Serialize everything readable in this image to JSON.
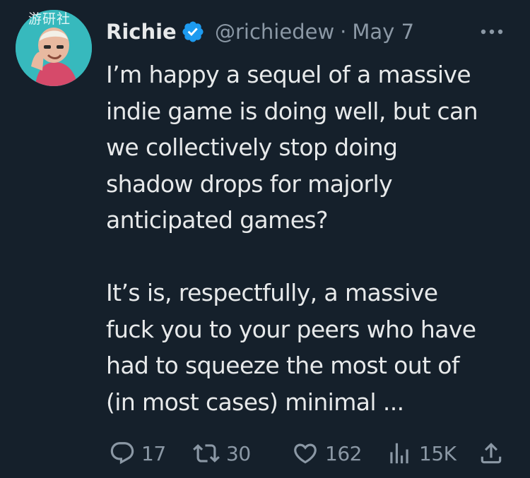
{
  "watermark": "游研社",
  "tweet": {
    "display_name": "Richie",
    "handle": "@richiedew",
    "separator": "·",
    "date": "May 7",
    "body_lines_p1": [
      "I’m happy a sequel of a massive",
      "indie game is doing well, but can",
      "we collectively stop doing",
      "shadow drops for majorly",
      "anticipated games?"
    ],
    "body_lines_p2": [
      "It’s is, respectfully, a massive",
      "fuck you to your peers who have",
      "had to squeeze the most out of",
      "(in most cases) minimal ..."
    ]
  },
  "actions": {
    "replies": "17",
    "retweets": "30",
    "likes": "162",
    "views": "15K"
  },
  "colors": {
    "background": "#15202b",
    "text": "#e7e9ea",
    "secondary": "#8b98a5",
    "verified": "#1d9bf0"
  },
  "icons": [
    "reply-icon",
    "retweet-icon",
    "like-icon",
    "views-icon",
    "share-icon",
    "more-icon",
    "verified-badge-icon"
  ]
}
